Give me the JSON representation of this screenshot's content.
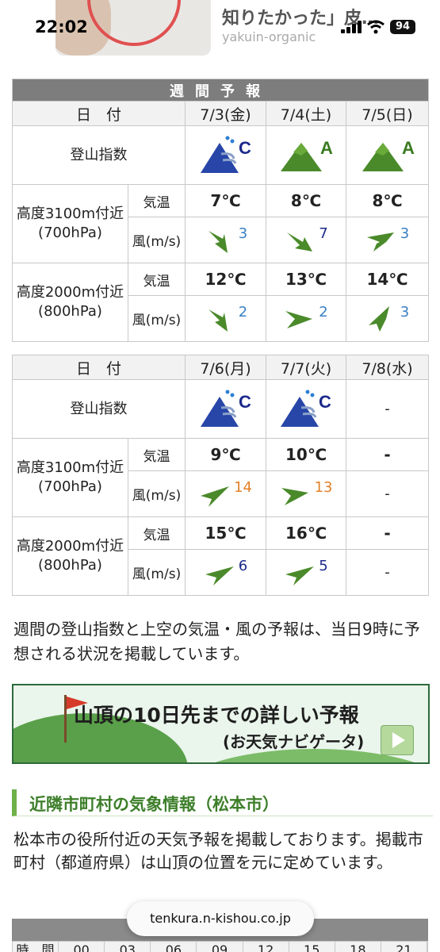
{
  "status": {
    "time": "22:02",
    "battery": "94"
  },
  "ad": {
    "title": "知りたかった」皮…",
    "sub": "yakuin-organic"
  },
  "weekly_title": "週間予報",
  "row_labels": {
    "date": "日　付",
    "index": "登山指数",
    "h3100": "高度3100m付近",
    "h3100p": "(700hPa)",
    "h2000": "高度2000m付近",
    "h2000p": "(800hPa)",
    "temp": "気温",
    "wind": "風(m/s)"
  },
  "week1": {
    "days": [
      "7/3(金)",
      "7/4(土)",
      "7/5(日)"
    ],
    "index": [
      "C",
      "A",
      "A"
    ],
    "t3100": [
      "7℃",
      "8℃",
      "8℃"
    ],
    "w3100": [
      "3",
      "7",
      "3"
    ],
    "t2000": [
      "12℃",
      "13℃",
      "14℃"
    ],
    "w2000": [
      "2",
      "2",
      "3"
    ]
  },
  "week2": {
    "days": [
      "7/6(月)",
      "7/7(火)",
      "7/8(水)"
    ],
    "index": [
      "C",
      "C",
      "-"
    ],
    "t3100": [
      "9℃",
      "10℃",
      "-"
    ],
    "w3100": [
      "14",
      "13",
      "-"
    ],
    "t2000": [
      "15℃",
      "16℃",
      "-"
    ],
    "w2000": [
      "6",
      "5",
      "-"
    ]
  },
  "note": "週間の登山指数と上空の気温・風の予報は、当日9時に予想される状況を掲載しています。",
  "banner": {
    "line1": "山頂の10日先までの詳しい予報",
    "line2": "(お天気ナビゲータ)"
  },
  "section": {
    "title": "近隣市町村の気象情報（松本市）",
    "desc": "松本市の役所付近の天気予報を掲載しております。掲載市町村（都道府県）は山頂の位置を元に定めています。"
  },
  "bottom": {
    "time_label": "時　間",
    "hours": [
      "00",
      "03",
      "06",
      "09",
      "12",
      "15",
      "18",
      "21"
    ]
  },
  "url": "tenkura.n-kishou.co.jp",
  "colors": {
    "mountain_green": "#4a8a2a",
    "mountain_blue": "#2846a8",
    "band": "#7d7d7d"
  }
}
